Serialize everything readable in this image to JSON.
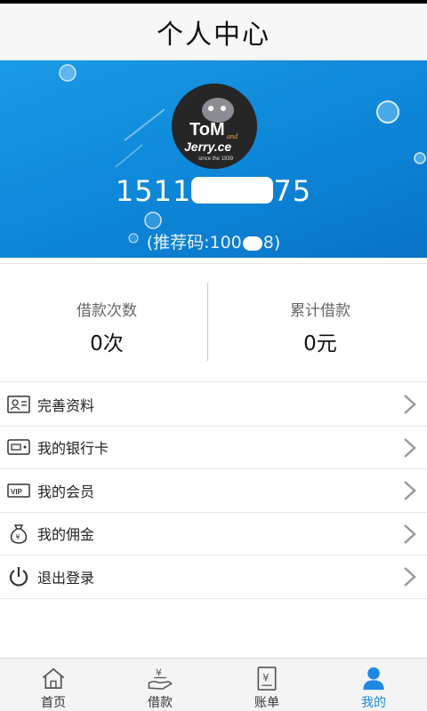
{
  "header": {
    "title": "个人中心"
  },
  "profile": {
    "avatar_text": {
      "line1": "ToM",
      "line2": "Jerry.ce",
      "line3": "since the 1939",
      "badge": "and"
    },
    "phone_prefix": "1511",
    "phone_suffix": "75",
    "referral_prefix": "(推荐码:100",
    "referral_suffix": "8)"
  },
  "stats": [
    {
      "label": "借款次数",
      "value": "0次"
    },
    {
      "label": "累计借款",
      "value": "0元"
    }
  ],
  "menu": {
    "items": [
      {
        "label": "完善资料",
        "icon": "id-card-icon"
      },
      {
        "label": "我的银行卡",
        "icon": "bank-card-icon"
      },
      {
        "label": "我的会员",
        "icon": "vip-icon"
      },
      {
        "label": "我的佣金",
        "icon": "money-bag-icon"
      },
      {
        "label": "退出登录",
        "icon": "power-icon"
      }
    ]
  },
  "tabbar": {
    "items": [
      {
        "label": "首页",
        "icon": "home-icon",
        "active": false
      },
      {
        "label": "借款",
        "icon": "loan-hand-icon",
        "active": false
      },
      {
        "label": "账单",
        "icon": "bill-icon",
        "active": false
      },
      {
        "label": "我的",
        "icon": "user-icon",
        "active": true
      }
    ],
    "active_color": "#1e88e5"
  },
  "colors": {
    "hero_blue": "#1a9be6",
    "accent": "#1e88e5"
  }
}
